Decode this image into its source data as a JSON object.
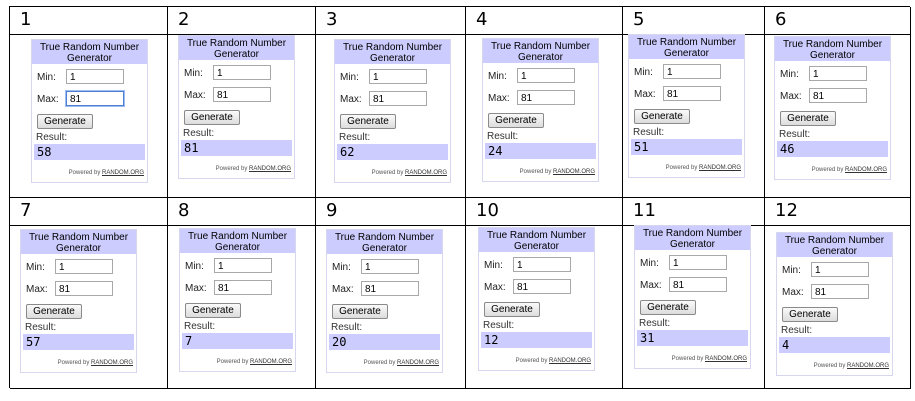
{
  "widget": {
    "title": "True Random Number Generator",
    "min_label": "Min:",
    "max_label": "Max:",
    "button_label": "Generate",
    "result_label": "Result:",
    "powered_prefix": "Powered by",
    "powered_link": "RANDOM.ORG"
  },
  "panels": [
    {
      "number": "1",
      "min": "1",
      "max": "81",
      "result": "58"
    },
    {
      "number": "2",
      "min": "1",
      "max": "81",
      "result": "81"
    },
    {
      "number": "3",
      "min": "1",
      "max": "81",
      "result": "62"
    },
    {
      "number": "4",
      "min": "1",
      "max": "81",
      "result": "24"
    },
    {
      "number": "5",
      "min": "1",
      "max": "81",
      "result": "51"
    },
    {
      "number": "6",
      "min": "1",
      "max": "81",
      "result": "46"
    },
    {
      "number": "7",
      "min": "1",
      "max": "81",
      "result": "57"
    },
    {
      "number": "8",
      "min": "1",
      "max": "81",
      "result": "7"
    },
    {
      "number": "9",
      "min": "1",
      "max": "81",
      "result": "20"
    },
    {
      "number": "10",
      "min": "1",
      "max": "81",
      "result": "12"
    },
    {
      "number": "11",
      "min": "1",
      "max": "81",
      "result": "31"
    },
    {
      "number": "12",
      "min": "1",
      "max": "81",
      "result": "4"
    }
  ]
}
